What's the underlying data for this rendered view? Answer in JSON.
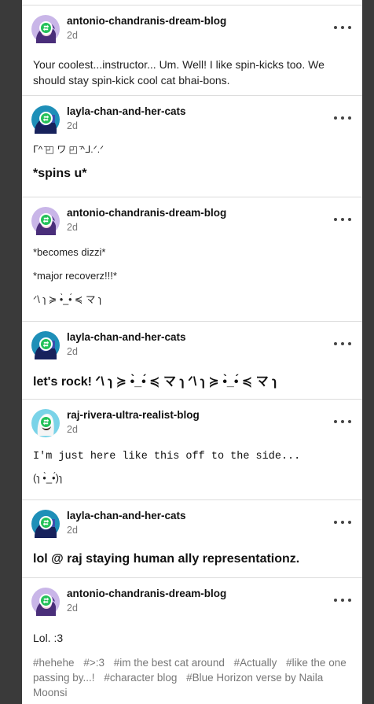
{
  "colors": {
    "badge": "#23c159",
    "name": "#111111",
    "meta": "#777777",
    "background": "#3a3a3a"
  },
  "icons": {
    "more": "more-options-icon",
    "badge": "reblog-badge-icon"
  },
  "posts": [
    {
      "blog": "antonio-chandranis-dream-blog",
      "time": "2d",
      "lines": [
        "Your coolest...instructor... Um. Well! I like spin-kicks too. We should stay spin-kick cool cat bhai-bons."
      ]
    },
    {
      "blog": "layla-chan-and-her-cats",
      "time": "2d",
      "lines": [
        "ᒥ^ ̄◰ ワ ◰ ̄^ᒧ.ᐟ.ᐟ",
        "*spins u*"
      ]
    },
    {
      "blog": "antonio-chandranis-dream-blog",
      "time": "2d",
      "lines": [
        "*becomes dizzi*",
        "*major recoverz!!!*",
        "ᐟ\\ ɿ ≽ •̀_•́ ≼ マ ɿ"
      ]
    },
    {
      "blog": "layla-chan-and-her-cats",
      "time": "2d",
      "lines": [
        "let's rock! ᐟ\\ ɿ ≽ •̀_•́ ≼ マ ɿ ᐟ\\ ɿ ≽ •̀_•́ ≼ マ ɿ"
      ]
    },
    {
      "blog": "raj-rivera-ultra-realist-blog",
      "time": "2d",
      "lines": [
        "I'm just here like this off to the side...",
        "(ɿ •̀_•́)ɿ"
      ]
    },
    {
      "blog": "layla-chan-and-her-cats",
      "time": "2d",
      "lines": [
        "lol @ raj staying human ally representationz."
      ]
    },
    {
      "blog": "antonio-chandranis-dream-blog",
      "time": "2d",
      "lines": [
        "Lol. :3"
      ],
      "tags": [
        "#hehehe",
        "#>:3",
        "#im the best cat around",
        "#Actually",
        "#like the one passing by...!",
        "#character blog",
        "#Blue Horizon verse by Naila Moonsi"
      ]
    }
  ]
}
